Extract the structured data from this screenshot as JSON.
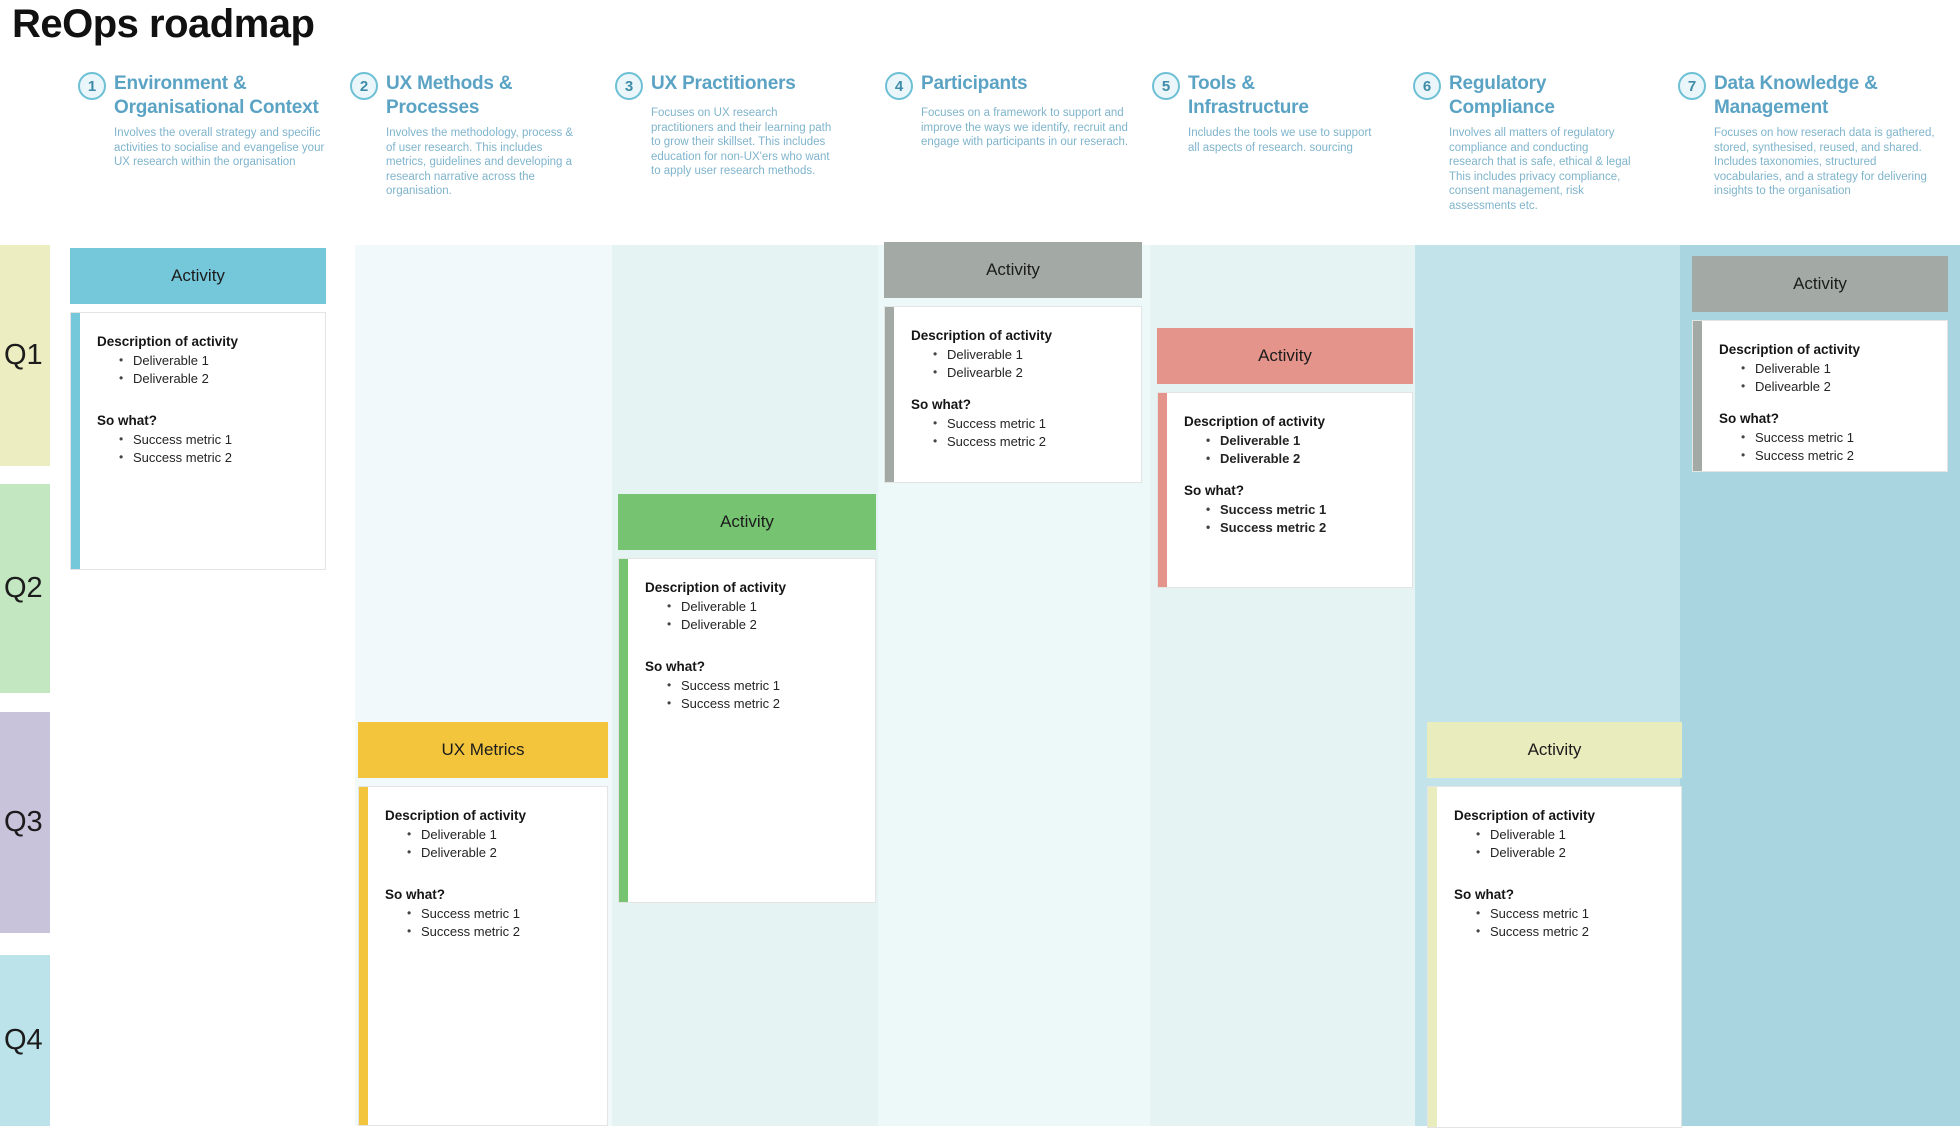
{
  "title": "ReOps roadmap",
  "quarters": [
    {
      "label": "Q1",
      "color": "#ecedc0"
    },
    {
      "label": "Q2",
      "color": "#c3e8c1"
    },
    {
      "label": "Q3",
      "color": "#c8c2da"
    },
    {
      "label": "Q4",
      "color": "#bce3e9"
    }
  ],
  "columns": [
    {
      "num": "1",
      "title": "Environment & Organisational Context",
      "desc": "Involves the overall strategy and specific  activities to socialise and evangelise your UX research within the organisation",
      "band_color": "transparent"
    },
    {
      "num": "2",
      "title": "UX Methods & Processes",
      "desc": "Involves the methodology, process & of user research. This includes metrics,  guidelines and developing a research narrative across the organisation.",
      "band_color": "#f1f9fa"
    },
    {
      "num": "3",
      "title": "UX Practitioners",
      "desc": "Focuses on UX research practitioners and their learning path to grow their skillset. This includes education for non-UX'ers who want to apply user research methods.",
      "band_color": "#e5f3f3"
    },
    {
      "num": "4",
      "title": "Participants",
      "desc": "Focuses on a framework to support and improve the ways  we identify, recruit and engage with participants in our reserach.",
      "band_color": "#edf8f9"
    },
    {
      "num": "5",
      "title": "Tools & Infrastructure",
      "desc": "Includes the tools we use to support all aspects of research. sourcing",
      "band_color": "#e5f3f3"
    },
    {
      "num": "6",
      "title": "Regulatory Compliance",
      "desc": "Involves all matters of regulatory compliance and conducting research that is safe, ethical & legal This includes privacy compliance, consent management, risk assessments etc.",
      "band_color": "#c3e3ea"
    },
    {
      "num": "7",
      "title": "Data Knowledge & Management",
      "desc": "Focuses on how reserach data is gathered, stored, synthesised, reused, and shared. Includes taxonomies, structured vocabularies, and a strategy for delivering insights to the organisation",
      "band_color": "#a9d5e0"
    }
  ],
  "cards": [
    {
      "id": "card-col1",
      "header": "Activity",
      "header_color": "#74c8da",
      "accent_color": "#74c8da",
      "desc_title": "Description of activity",
      "deliverables": [
        "Deliverable 1",
        "Deliverable 2"
      ],
      "sowhat_title": "So what?",
      "metrics": [
        "Success metric 1",
        "Success metric 2"
      ],
      "bold_items": false
    },
    {
      "id": "card-col2",
      "header": "UX Metrics",
      "header_color": "#f2c53d",
      "accent_color": "#f2c53d",
      "desc_title": "Description of activity",
      "deliverables": [
        "Deliverable 1",
        "Deliverable 2"
      ],
      "sowhat_title": "So what?",
      "metrics": [
        "Success metric 1",
        "Success metric 2"
      ],
      "bold_items": false
    },
    {
      "id": "card-col3",
      "header": "Activity",
      "header_color": "#76c472",
      "accent_color": "#76c472",
      "desc_title": "Description of activity",
      "deliverables": [
        "Deliverable 1",
        "Deliverable 2"
      ],
      "sowhat_title": "So what?",
      "metrics": [
        "Success metric 1",
        "Success metric 2"
      ],
      "bold_items": false
    },
    {
      "id": "card-col4",
      "header": "Activity",
      "header_color": "#a3aaa6",
      "accent_color": "#a3aaa6",
      "desc_title": "Description of activity",
      "deliverables": [
        "Deliverable 1",
        "Delivearble 2"
      ],
      "sowhat_title": "So what?",
      "metrics": [
        "Success metric 1",
        "Success metric 2"
      ],
      "bold_items": false
    },
    {
      "id": "card-col5",
      "header": "Activity",
      "header_color": "#e4948a",
      "accent_color": "#e4948a",
      "desc_title": "Description of activity",
      "deliverables": [
        "Deliverable 1",
        "Deliverable 2"
      ],
      "sowhat_title": "So what?",
      "metrics": [
        "Success metric 1",
        "Success metric 2"
      ],
      "bold_items": true
    },
    {
      "id": "card-col6",
      "header": "Activity",
      "header_color": "#e9ecbd",
      "accent_color": "#e9ecbd",
      "desc_title": "Description of activity",
      "deliverables": [
        "Deliverable 1",
        "Deliverable 2"
      ],
      "sowhat_title": "So what?",
      "metrics": [
        "Success metric 1",
        "Success metric 2"
      ],
      "bold_items": false
    },
    {
      "id": "card-col7",
      "header": "Activity",
      "header_color": "#a3aaa6",
      "accent_color": "#a3aaa6",
      "desc_title": "Description of activity",
      "deliverables": [
        "Deliverable 1",
        "Delivearble 2"
      ],
      "sowhat_title": "So what?",
      "metrics": [
        "Success metric 1",
        "Success metric 2"
      ],
      "bold_items": false
    }
  ]
}
